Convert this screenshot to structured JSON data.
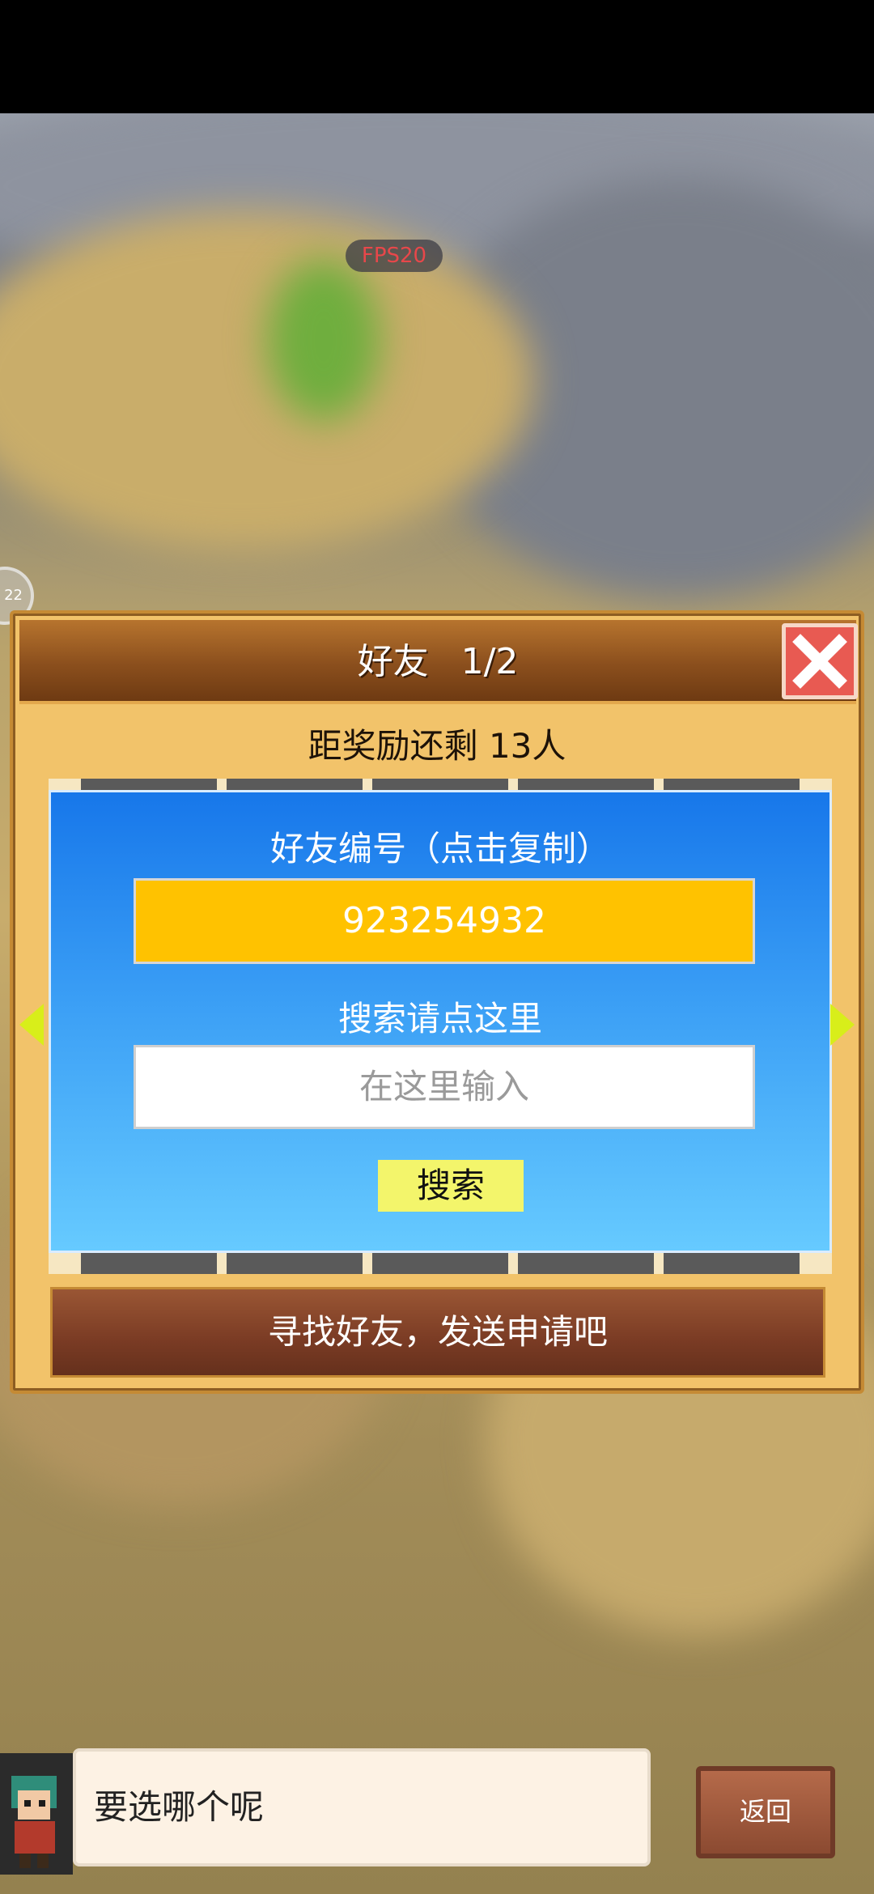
{
  "hud": {
    "fps": "FPS20",
    "side_badge": "22"
  },
  "dialog": {
    "title": "好友",
    "page": "1/2",
    "subtitle": "距奖励还剩 13人",
    "friend_id_label": "好友编号（点击复制）",
    "friend_id": "923254932",
    "search_label": "搜索请点这里",
    "search_placeholder": "在这里输入",
    "search_button": "搜索",
    "find_button": "寻找好友，发送申请吧"
  },
  "footer": {
    "speech": "要选哪个呢",
    "back_button": "返回"
  },
  "colors": {
    "panel_blue": "#1777ea",
    "id_box": "#ffc200",
    "search_button": "#f3f56b",
    "close_button": "#e85a52",
    "arrow": "#d8ee1a"
  }
}
